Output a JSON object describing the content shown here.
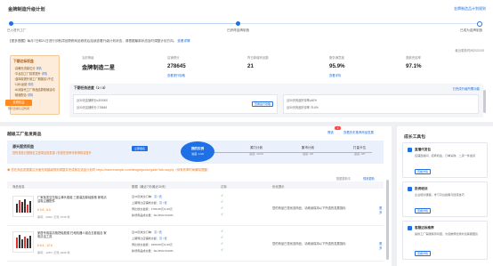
{
  "header": {
    "title": "金牌制造升级计划",
    "top_link": "金牌制造品计划规则"
  },
  "steps": [
    {
      "label": "已入驻代工厂"
    },
    {
      "label": "已获得金牌制造"
    },
    {
      "label": "已成为金牌制造"
    }
  ],
  "notice": {
    "text": "【更多提醒】每月7日和21日进行诊断并回顾修商品修改后连续查看升级计划状态，请根据最新状态及时调整计划方向。",
    "link": "查看详情"
  },
  "right_note": "最近更新时间2022/05",
  "sidebar": {
    "title": "下期达标权益",
    "items": [
      {
        "label": "·高曝光流量位分",
        "tag": "详情"
      },
      {
        "label": "·平台加工厂权重提升",
        "tag": "详情"
      },
      {
        "label": "·选择权提升到工厂期报名1千位",
        "tag": ""
      },
      {
        "label": "·1对1运营",
        "tag": "详情"
      },
      {
        "label": "·AI对接代工厂商品结算营销活动",
        "tag": ""
      },
      {
        "label": "·制造配合",
        "tag": "详情"
      }
    ],
    "button": "查看权益",
    "note": "预计达成认证时间"
  },
  "stats": [
    {
      "label": "当前等级",
      "value": "金牌制造二星",
      "link": ""
    },
    {
      "label": "店铺得分",
      "value": "278645",
      "link": "查看提升攻略"
    },
    {
      "label": "昨日新增商品数",
      "value": "21",
      "link": ""
    },
    {
      "label": "服务满意度",
      "value": "95.9%",
      "link": "查看详情"
    },
    {
      "label": "退款完结率",
      "value": "97.1%",
      "link": ""
    }
  ],
  "progress": {
    "title": "下期任务进度（2 / 3）",
    "right_link": "已完成升级所需功能",
    "tasks": [
      {
        "line1": "近30天店铺积分≥300000",
        "line2": "近30天店铺积分 278645",
        "button": "查看提升攻略"
      },
      {
        "line1": "近30天商品好评率≥60%",
        "line2": "近30天商品好评率 75.6%",
        "button": ""
      },
      {
        "line1": "近30天有效评价≥3条",
        "line2": "近30天有效评价 12条",
        "button": ""
      }
    ]
  },
  "main": {
    "title": "越级工厂批发商品",
    "mini_button": "筛选",
    "badge": "3",
    "link": "查看历史推荐商品发展",
    "banner": {
      "title": "源头提货权益",
      "sub": "您的货品已提报至主营类目批发源 | 完成任务即可获得排名提升",
      "button": "立即报名"
    },
    "step2": [
      {
        "label": "源力计划",
        "sub": "进度: 10/10"
      },
      {
        "label": "集市计划",
        "sub": "进度: 0/5"
      },
      {
        "label": "打量卡位",
        "sub": "进度: 0/5"
      }
    ],
    "active_step": {
      "label": "我的实例",
      "sub": "进度: 1/10"
    },
    "warning": "您在商品发展建议页面完成越级规则调整并完成报名选品计划时 https://www.example.com/design/goods/guide?tab=supply（待有效率时间解除提醒）",
    "warn_right": "数据更新中",
    "warn_right_link": "规则更新",
    "table_headers": [
      "商品信息",
      "数据（最近7天/最近30天）",
      "达标",
      "优化提示"
    ],
    "rows": [
      {
        "name": "厂家批发空压吸尘棒头套组 三套装加厚硅胶拖 家电清洁吸尘器配件",
        "price": "¥ 5.8 - 8.6",
        "stock": "库存：4092 | 已售 3745 件",
        "detail": [
          {
            "k": "近30天成交订单",
            "v": "高 / 低"
          },
          {
            "k": "上期同比店铺成交额",
            "v": "高 / 低"
          },
          {
            "k": "同比成交金额",
            "v": "1760.36元/1.00元"
          },
          {
            "k": "新增商品成交量",
            "v": "82.26%/70.00%"
          }
        ],
        "option": "您的商品已是优选商品，请继续保持以下所选的发展指标",
        "more": "更多"
      },
      {
        "name": "家居专用高清拖把硅胶套 扫地机器人组合五套组合 家电清洁工具",
        "price": "¥ 8.4 - 12.6",
        "stock": "库存：1287 | 已售 2930 件",
        "detail": [
          {
            "k": "近30天成交订单",
            "v": "高 / 低"
          },
          {
            "k": "上期同比店铺成交额",
            "v": "高 / 低"
          },
          {
            "k": "同比成交金额",
            "v": "1693.05元/1.00元"
          },
          {
            "k": "新增商品成交量",
            "v": "82.26%/70.00%"
          }
        ],
        "option": "您的商品已是优选商品，请继续保持以下所选的发展指标",
        "more": "更多"
      }
    ]
  },
  "tools": {
    "title": "成长工具包",
    "items": [
      {
        "name": "直播代发包",
        "desc": "店铺直播间、招商机会、订单采购、二货一件发货",
        "button": "查看详情"
      },
      {
        "name": "投资培训",
        "desc": "企业培训课程，学习平台政策与经营技巧",
        "button": "查看详情"
      },
      {
        "name": "客服达标推荐",
        "desc": "提供工厂客服接待问题，为您推荐优秀外包客服团队",
        "button": "查看详情"
      }
    ]
  }
}
